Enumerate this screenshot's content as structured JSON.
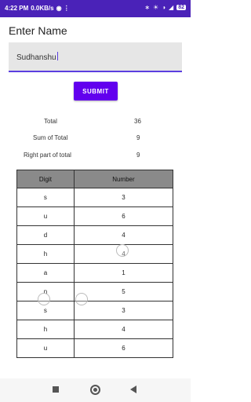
{
  "status_bar": {
    "time": "4:22 PM",
    "speed": "0.0KB/s",
    "battery": "82"
  },
  "form": {
    "title": "Enter Name",
    "name_value": "Sudhanshu",
    "submit_label": "SUBMIT"
  },
  "stats": {
    "total_label": "Total",
    "total_value": "36",
    "sum_label": "Sum of Total",
    "sum_value": "9",
    "right_label": "Right part of total",
    "right_value": "9"
  },
  "table": {
    "headers": [
      "Digit",
      "Number"
    ],
    "rows": [
      [
        "s",
        "3"
      ],
      [
        "u",
        "6"
      ],
      [
        "d",
        "4"
      ],
      [
        "h",
        "4"
      ],
      [
        "a",
        "1"
      ],
      [
        "n",
        "5"
      ],
      [
        "s",
        "3"
      ],
      [
        "h",
        "4"
      ],
      [
        "u",
        "6"
      ]
    ]
  },
  "colors": {
    "status_bar": "#4a22b8",
    "accent": "#6200ee"
  }
}
